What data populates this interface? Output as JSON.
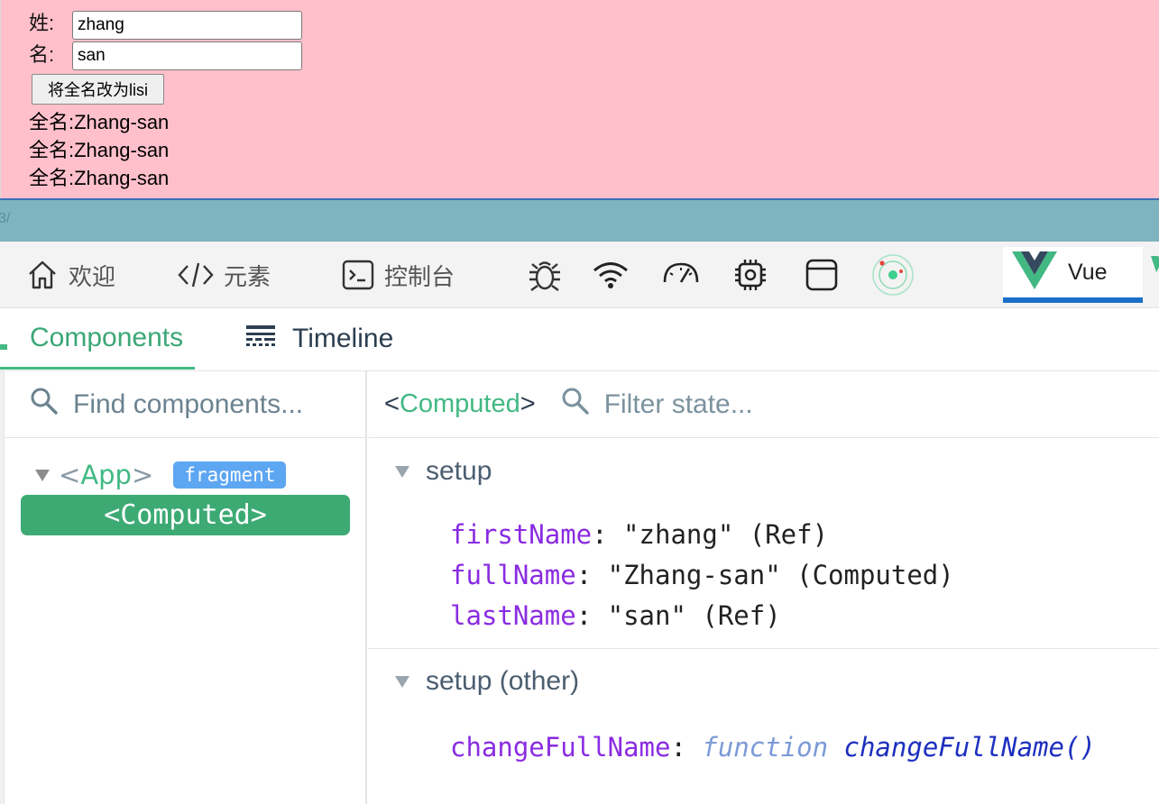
{
  "app": {
    "surname_label": "姓:",
    "surname_value": "zhang",
    "given_label": "名:",
    "given_value": "san",
    "button_label": "将全名改为lisi",
    "fullname_lines": [
      "全名:Zhang-san",
      "全名:Zhang-san",
      "全名:Zhang-san"
    ]
  },
  "teal_strip": {
    "fragment_text": "3/"
  },
  "devtools_tabs": {
    "welcome": "欢迎",
    "elements": "元素",
    "console": "控制台",
    "vue": "Vue"
  },
  "vue_nav": {
    "components": "Components",
    "timeline": "Timeline"
  },
  "component_tree": {
    "search_placeholder": "Find components...",
    "root": {
      "open": "<",
      "name": "App",
      "close": ">",
      "badge": "fragment"
    },
    "selected": "<Computed>"
  },
  "inspector": {
    "header_open": "<",
    "header_name": "Computed",
    "header_close": ">",
    "filter_placeholder": "Filter state...",
    "sections": [
      {
        "title": "setup",
        "props": [
          {
            "key": "firstName",
            "value": ": \"zhang\" (Ref)"
          },
          {
            "key": "fullName",
            "value": ": \"Zhang-san\" (Computed)"
          },
          {
            "key": "lastName",
            "value": ": \"san\" (Ref)"
          }
        ]
      },
      {
        "title": "setup (other)",
        "props": [
          {
            "key": "changeFullName",
            "sep": ": ",
            "fn_kw": "function",
            "fn_name": "changeFullName()"
          }
        ]
      }
    ]
  },
  "colors": {
    "app_bg": "#ffc0cb",
    "teal_strip": "#7fb3bf",
    "vue_green": "#42b883",
    "selected_bg": "#3daa74",
    "badge_blue": "#5da6f2",
    "key_purple": "#8a2be2",
    "active_underline": "#1a6fc9"
  }
}
